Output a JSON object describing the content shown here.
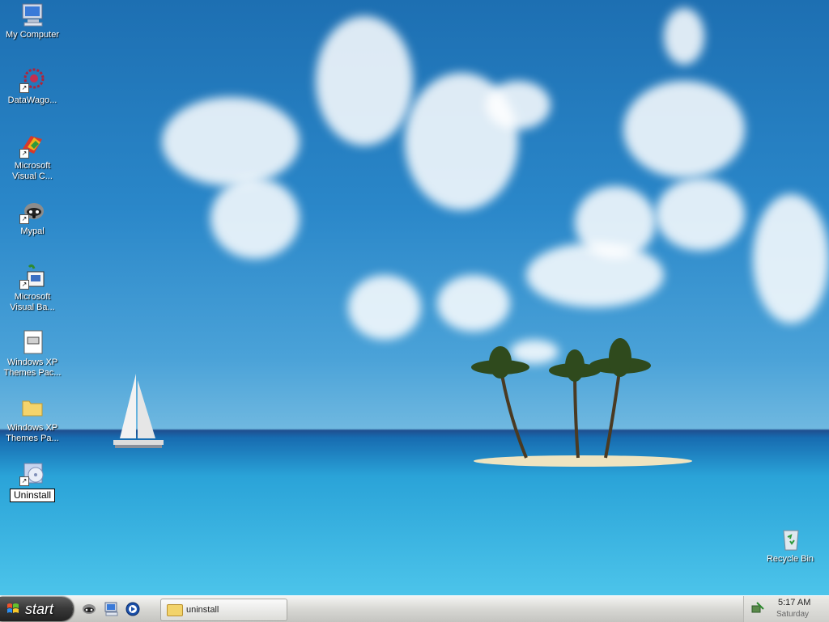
{
  "desktop": {
    "icons": [
      {
        "label": "My Computer"
      },
      {
        "label": "DataWago..."
      },
      {
        "label": "Microsoft Visual C..."
      },
      {
        "label": "Mypal"
      },
      {
        "label": "Microsoft Visual Ba..."
      },
      {
        "label": "Windows XP Themes Pac..."
      },
      {
        "label": "Windows XP Themes Pa..."
      },
      {
        "label": "Uninstall"
      }
    ],
    "recycle_bin": {
      "label": "Recycle Bin"
    }
  },
  "taskbar": {
    "start_label": "start",
    "quick_launch": [
      "mypal-icon",
      "computer-icon",
      "media-player-icon"
    ],
    "task_button": {
      "label": "uninstall"
    },
    "clock": {
      "time": "5:17 AM",
      "day": "Saturday"
    }
  }
}
